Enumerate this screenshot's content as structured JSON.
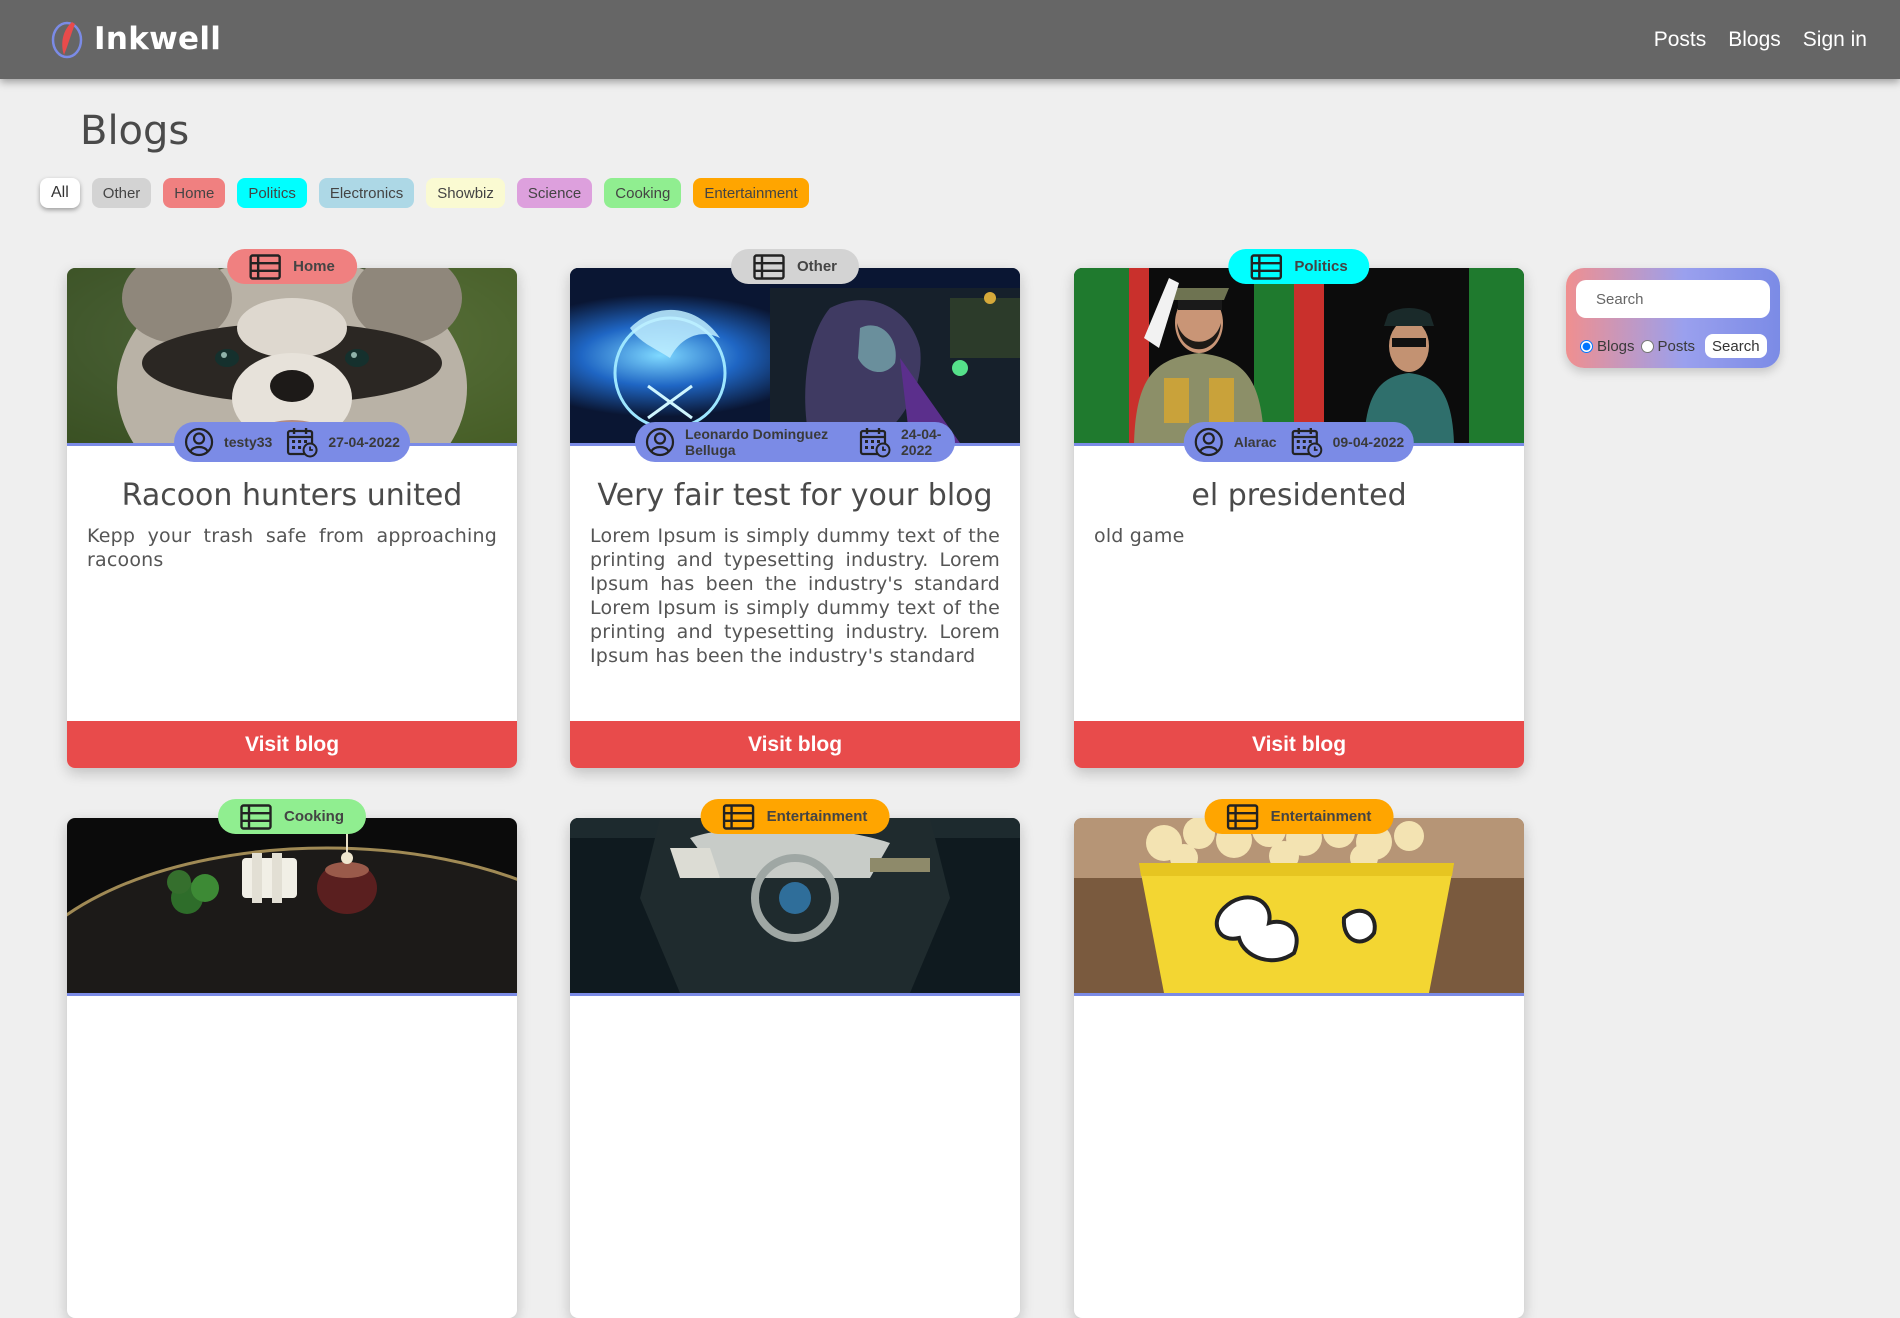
{
  "header": {
    "brand": "Inkwell",
    "nav": [
      "Posts",
      "Blogs",
      "Sign in"
    ]
  },
  "page_title": "Blogs",
  "filters": [
    {
      "label": "All",
      "color": "#ffffff",
      "active": true
    },
    {
      "label": "Other",
      "color": "#d3d3d3"
    },
    {
      "label": "Home",
      "color": "#f08080"
    },
    {
      "label": "Politics",
      "color": "#00ffff"
    },
    {
      "label": "Electronics",
      "color": "#add8e6"
    },
    {
      "label": "Showbiz",
      "color": "#fafad2"
    },
    {
      "label": "Science",
      "color": "#dda0dd"
    },
    {
      "label": "Cooking",
      "color": "#90ee90"
    },
    {
      "label": "Entertainment",
      "color": "#ffa500"
    }
  ],
  "cards": [
    {
      "category": "Home",
      "category_color": "#f08080",
      "image": "raccoon-photo",
      "author": "testy33",
      "date": "27-04-2022",
      "title": "Racoon hunters united",
      "description": "Kepp your trash safe from approaching racoons",
      "button": "Visit blog"
    },
    {
      "category": "Other",
      "category_color": "#d3d3d3",
      "image": "starcraft-artwork",
      "author": "Leonardo Dominguez Belluga",
      "date": "24-04-2022",
      "title": "Very fair test for your blog",
      "description": "Lorem Ipsum is simply dummy text of the printing and typesetting industry. Lorem Ipsum has been the industry's standard Lorem Ipsum is simply dummy text of the printing and typesetting industry. Lorem Ipsum has been the industry's standard",
      "button": "Visit blog"
    },
    {
      "category": "Politics",
      "category_color": "#00ffff",
      "image": "dictator-photo",
      "author": "Alarac",
      "date": "09-04-2022",
      "title": "el presidented",
      "description": "old game",
      "button": "Visit blog"
    },
    {
      "category": "Cooking",
      "category_color": "#90ee90",
      "image": "plated-dish-photo"
    },
    {
      "category": "Entertainment",
      "category_color": "#ffa500",
      "image": "game-weapon-artwork"
    },
    {
      "category": "Entertainment",
      "category_color": "#ffa500",
      "image": "popcorn-bucket-photo"
    }
  ],
  "search": {
    "placeholder": "Search",
    "options": [
      "Blogs",
      "Posts"
    ],
    "selected": "Blogs",
    "button": "Search"
  },
  "colors": {
    "header_bg": "#666666",
    "page_bg": "#efefef",
    "meta_pill": "#7b8be6",
    "visit_button": "#e84b4b"
  }
}
